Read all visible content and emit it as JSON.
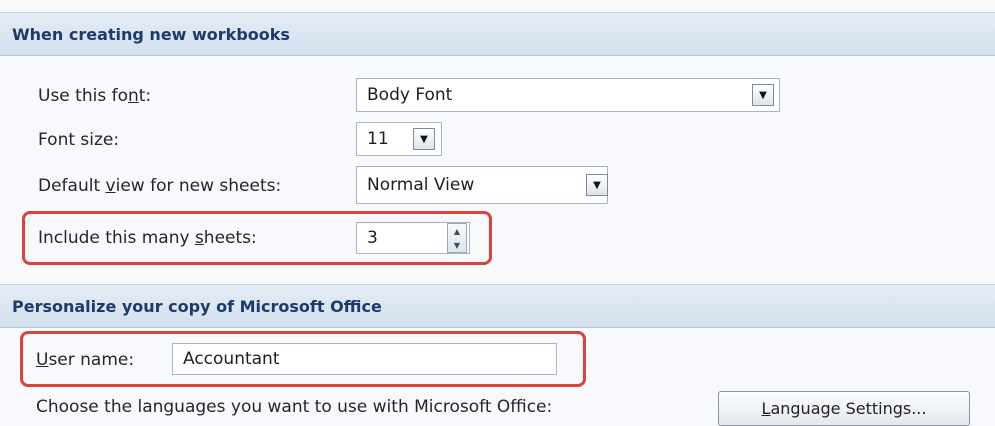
{
  "sections": {
    "workbooks_title": "When creating new workbooks",
    "personalize_title": "Personalize your copy of Microsoft Office"
  },
  "font": {
    "label_pre": "Use this fo",
    "label_key": "n",
    "label_post": "t:",
    "value": "Body Font"
  },
  "font_size": {
    "label": "Font size:",
    "value": "11"
  },
  "default_view": {
    "label_pre": "Default ",
    "label_key": "v",
    "label_post": "iew for new sheets:",
    "value": "Normal View"
  },
  "sheets": {
    "label_pre": "Include this many ",
    "label_key": "s",
    "label_post": "heets:",
    "value": "3"
  },
  "user": {
    "label_key": "U",
    "label_post": "ser name:",
    "value": "Accountant"
  },
  "languages": {
    "label": "Choose the languages you want to use with Microsoft Office:",
    "button_key": "L",
    "button_post": "anguage Settings..."
  },
  "icons": {
    "dropdown": "triangle-down",
    "spin_up": "triangle-up",
    "spin_down": "triangle-down"
  },
  "colors": {
    "highlight": "#d9433a",
    "header_text": "#1d3a68"
  }
}
